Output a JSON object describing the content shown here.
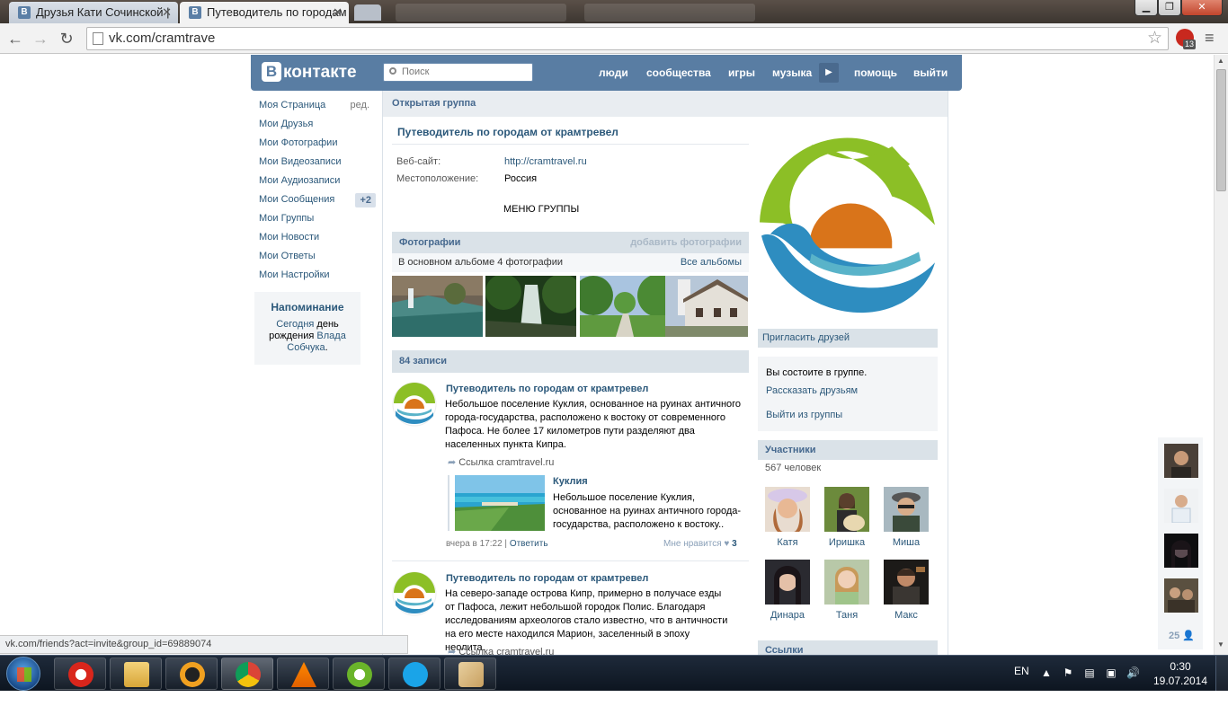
{
  "browser": {
    "tabs": [
      {
        "title": "Друзья Кати Сочинской |"
      },
      {
        "title": "Путеводитель по городам"
      }
    ],
    "url": "vk.com/cramtrave",
    "extension_badge": "13",
    "status_url": "vk.com/friends?act=invite&group_id=69889074"
  },
  "vk": {
    "logo": "контакте",
    "logo_letter": "В",
    "search_placeholder": "Поиск",
    "nav": [
      "люди",
      "сообщества",
      "игры",
      "музыка",
      "помощь",
      "выйти"
    ]
  },
  "left_menu": {
    "items": [
      {
        "label": "Моя Страница",
        "extra": "ред."
      },
      {
        "label": "Мои Друзья"
      },
      {
        "label": "Мои Фотографии"
      },
      {
        "label": "Мои Видеозаписи"
      },
      {
        "label": "Мои Аудиозаписи"
      },
      {
        "label": "Мои Сообщения",
        "badge": "+2"
      },
      {
        "label": "Мои Группы"
      },
      {
        "label": "Мои Новости"
      },
      {
        "label": "Мои Ответы"
      },
      {
        "label": "Мои Настройки"
      }
    ],
    "reminder": {
      "title": "Напоминание",
      "today": "Сегодня",
      "text1": " день рождения ",
      "person": "Влада Собчука",
      "end": "."
    }
  },
  "group": {
    "type": "Открытая группа",
    "title": "Путеводитель по городам от крамтревел",
    "website_label": "Веб-сайт:",
    "website": "http://cramtravel.ru",
    "location_label": "Местоположение:",
    "location": "Россия",
    "menu": "МЕНЮ ГРУППЫ",
    "photos": {
      "title": "Фотографии",
      "add": "добавить фотографии",
      "album_info": "В основном альбоме 4 фотографии",
      "all_albums": "Все альбомы"
    },
    "posts_count": "84 записи",
    "posts": [
      {
        "author": "Путеводитель по городам от крамтревел",
        "text": "Небольшое поселение Куклия, основанное на руинах античного города-государства, расположено к востоку от современного Пафоса. Не более 17 километров пути разделяют два населенных пункта Кипра.",
        "link": "Ссылка cramtravel.ru",
        "snippet_title": "Куклия",
        "snippet_text": "Небольшое поселение Куклия, основанное на руинах античного города-государства, расположено к востоку..",
        "time": "вчера в 17:22",
        "reply": "Ответить",
        "like": "Мне нравится",
        "likes": "3"
      },
      {
        "author": "Путеводитель по городам от крамтревел",
        "text": "На северо-западе острова Кипр, примерно в получасе езды от Пафоса, лежит небольшой городок Полис. Благодаря исследованиям археологов стало известно, что в античности на его месте находился Марион, заселенный в эпоху неолита.",
        "link": "Ссылка cramtravel.ru"
      }
    ]
  },
  "right": {
    "invite": "Пригласить друзей",
    "member_status": "Вы состоите в группе.",
    "tell_friends": "Рассказать друзьям",
    "leave": "Выйти из группы",
    "members_title": "Участники",
    "members_count": "567 человек",
    "members": [
      "Катя",
      "Иришка",
      "Миша",
      "Динара",
      "Таня",
      "Макс"
    ],
    "links_title": "Ссылки"
  },
  "online": {
    "count": "25"
  },
  "taskbar": {
    "lang": "EN",
    "time": "0:30",
    "date": "19.07.2014"
  },
  "colors": {
    "vk_blue": "#597da3",
    "link": "#2b587a",
    "section_bg": "#dae2e8"
  }
}
